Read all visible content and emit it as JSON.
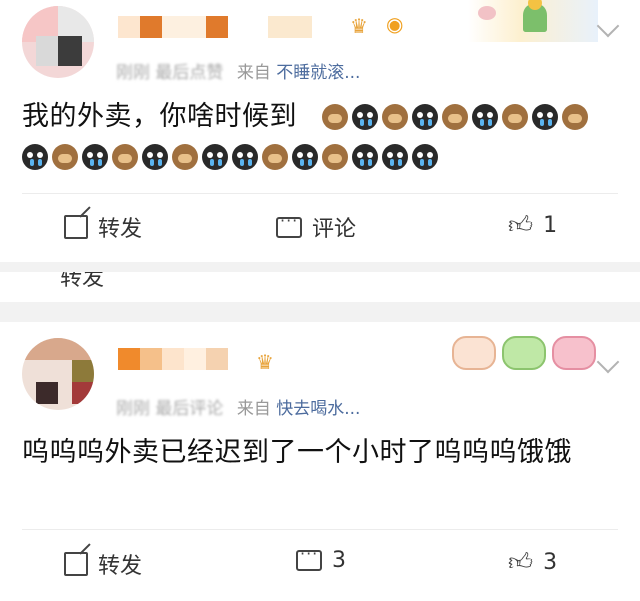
{
  "comments": [
    {
      "meta_prefix": "刚刚 最后点赞",
      "meta_from": "来自",
      "meta_source": "不睡就滚...",
      "text": "我的外卖，你啥时候到",
      "emoji_line1": [
        "monkey",
        "cry",
        "monkey",
        "cry",
        "monkey",
        "cry",
        "monkey",
        "cry",
        "monkey"
      ],
      "emoji_line2": [
        "cry",
        "monkey",
        "cry",
        "monkey",
        "cry",
        "monkey",
        "cry",
        "cry",
        "monkey",
        "cry",
        "monkey",
        "cry",
        "cry",
        "cry"
      ],
      "actions": {
        "share_label": "转发",
        "comment_label": "评论",
        "like_count": "1"
      }
    },
    {
      "meta_prefix": "刚刚 最后评论",
      "meta_from": "来自",
      "meta_source": "快去喝水...",
      "text": "呜呜呜外卖已经迟到了一个小时了呜呜呜饿饿",
      "actions": {
        "share_label": "转发",
        "comment_count": "3",
        "like_count": "3"
      }
    }
  ],
  "peek": {
    "text": "转发"
  },
  "icons": [
    "share-icon",
    "comment-icon",
    "like-icon",
    "chevron-down-icon",
    "vip-crown-icon"
  ],
  "colors": {
    "source_link": "#4d6c9e",
    "meta_gray": "#999999",
    "page_bg": "#f2f2f2"
  }
}
